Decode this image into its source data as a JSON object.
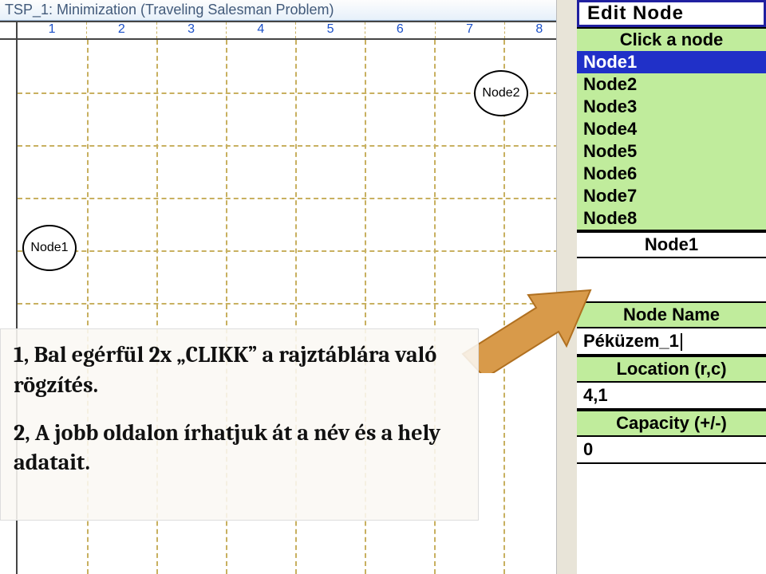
{
  "window": {
    "title": "TSP_1: Minimization (Traveling Salesman Problem)"
  },
  "grid": {
    "columns": [
      "1",
      "2",
      "3",
      "4",
      "5",
      "6",
      "7",
      "8"
    ]
  },
  "nodes_on_canvas": {
    "node1_label": "Node1",
    "node2_label": "Node2"
  },
  "panel": {
    "header": "Edit Node",
    "sub": "Click a node",
    "nodes": [
      "Node1",
      "Node2",
      "Node3",
      "Node4",
      "Node5",
      "Node6",
      "Node7",
      "Node8"
    ],
    "selected_index": 0,
    "bottom_selected": "Node1",
    "node_name_label": "Node Name",
    "node_name_value": "Péküzem_1",
    "location_label": "Location (r,c)",
    "location_value": "4,1",
    "capacity_label": "Capacity (+/-)",
    "capacity_value": "0"
  },
  "instructions": {
    "line1": "1, Bal egérfül 2x „CLIKK” a rajztáblára való rögzítés.",
    "line2": "2, A jobb oldalon írhatjuk át a név és a hely adatait."
  }
}
